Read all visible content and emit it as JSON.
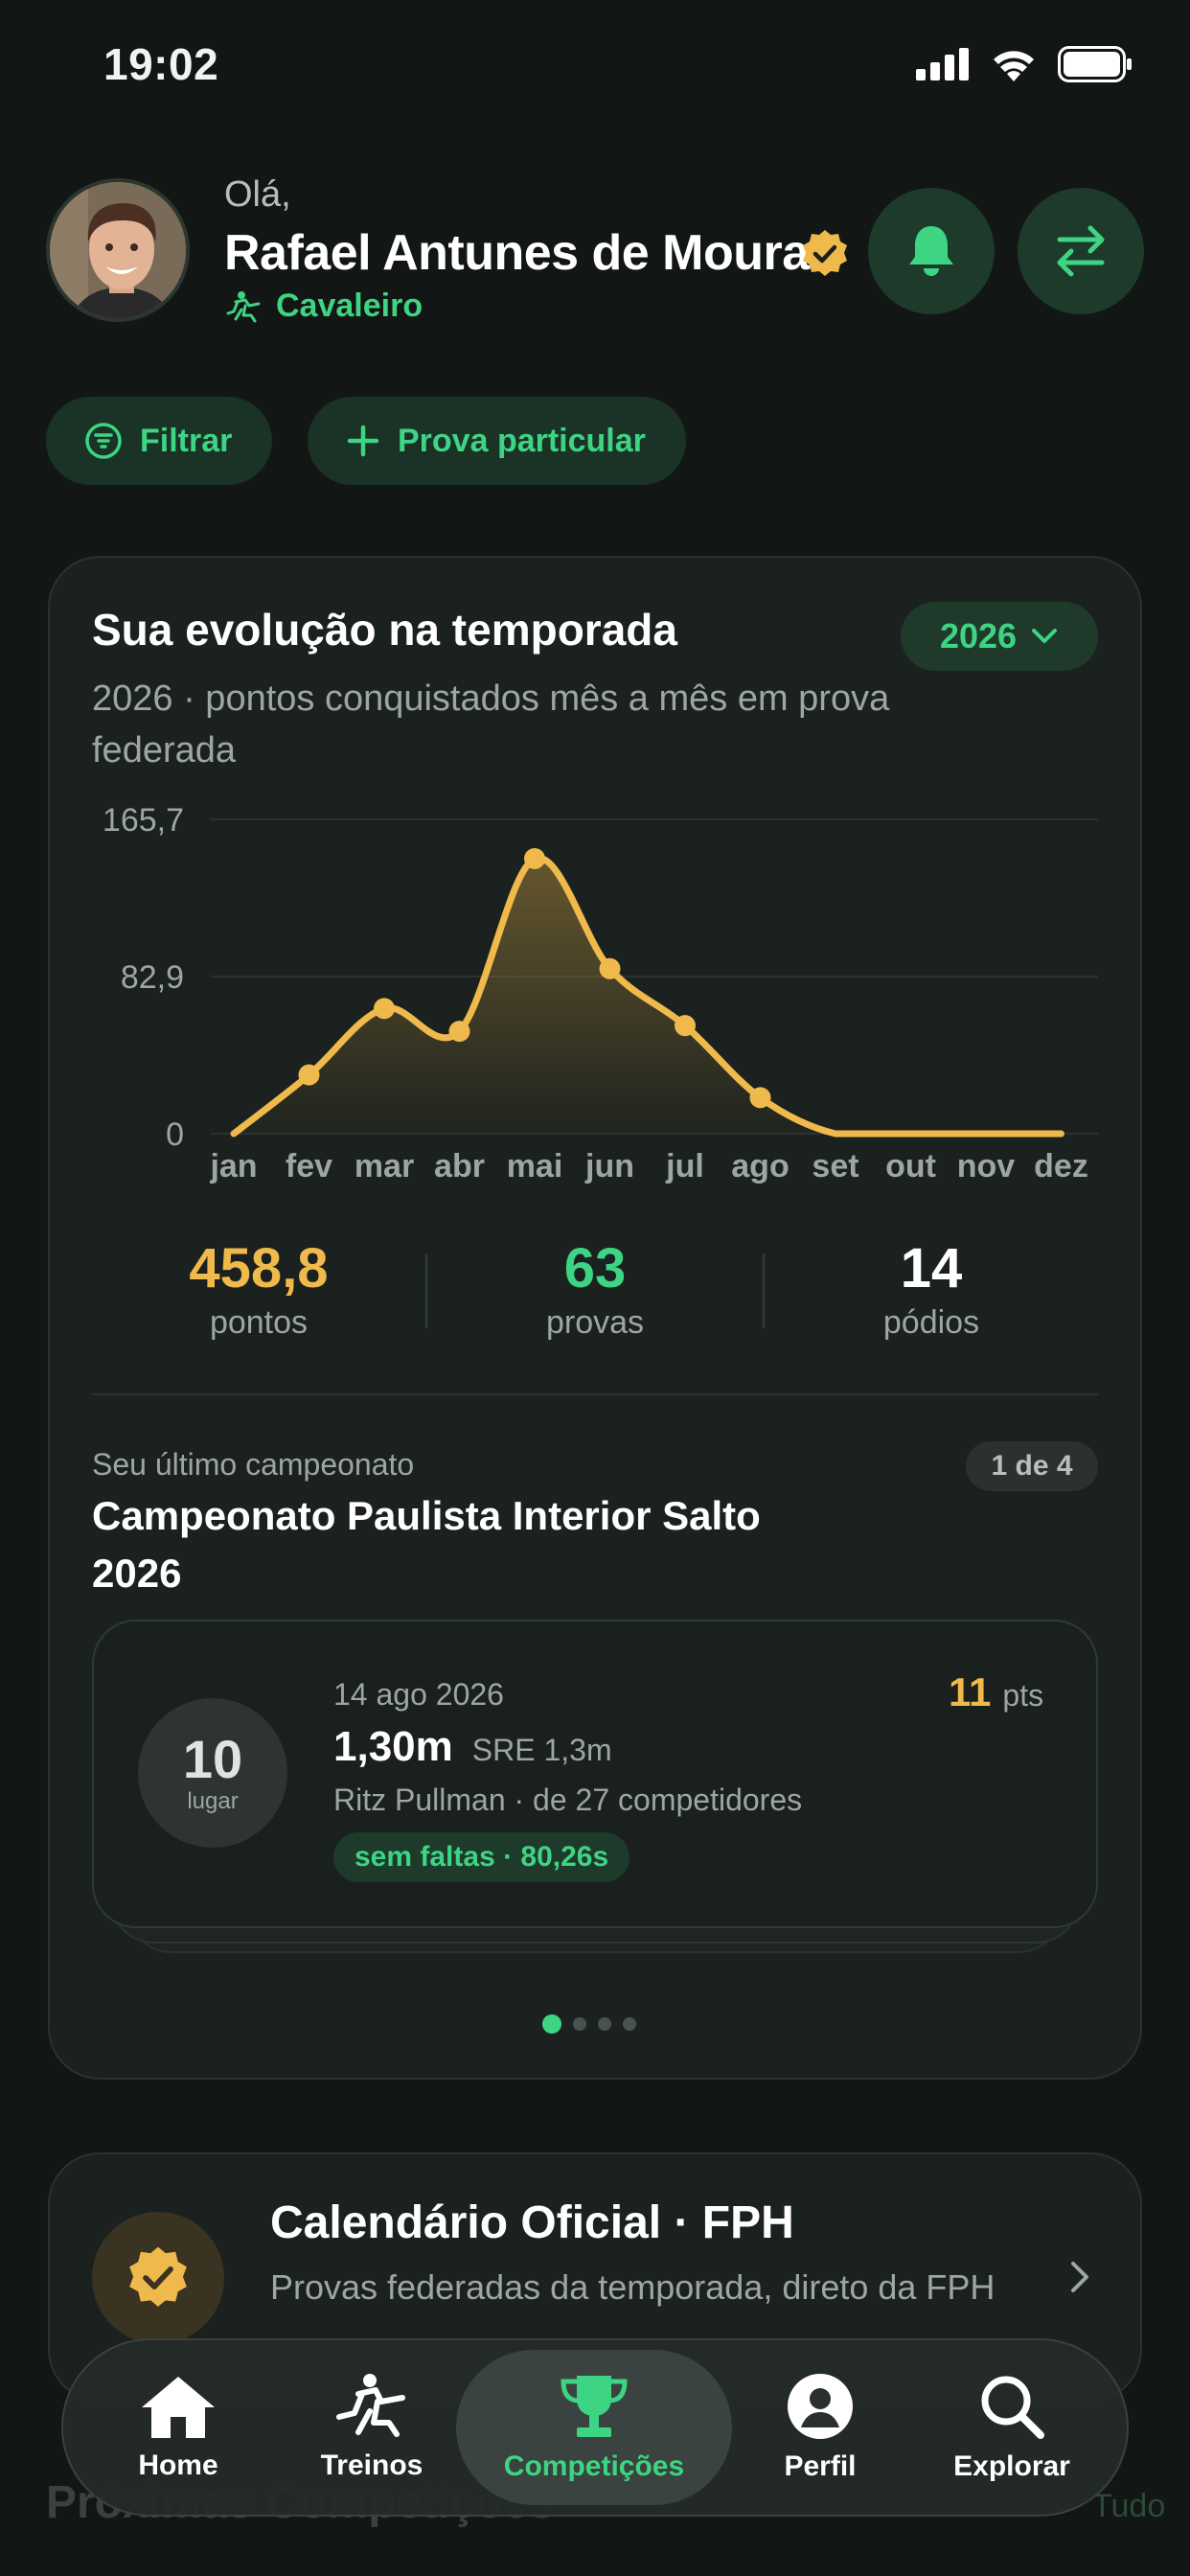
{
  "status_bar": {
    "time": "19:02"
  },
  "header": {
    "greeting": "Olá,",
    "name": "Rafael Antunes de Moura",
    "role": "Cavaleiro"
  },
  "actions": {
    "filter": "Filtrar",
    "private_event": "Prova particular"
  },
  "evolution": {
    "title": "Sua evolução na temporada",
    "year": "2026",
    "subtitle": "2026 · pontos conquistados mês a mês em prova federada",
    "stats": [
      {
        "value": "458,8",
        "label": "pontos",
        "color": "#f0b94b"
      },
      {
        "value": "63",
        "label": "provas",
        "color": "#3dd483"
      },
      {
        "value": "14",
        "label": "pódios",
        "color": "#ffffff"
      }
    ]
  },
  "chart_data": {
    "type": "area",
    "x": [
      "jan",
      "fev",
      "mar",
      "abr",
      "mai",
      "jun",
      "jul",
      "ago",
      "set",
      "out",
      "nov",
      "dez"
    ],
    "y_ticks": [
      "165,7",
      "82,9",
      "0"
    ],
    "ylim": [
      0,
      165.7
    ],
    "series": [
      {
        "values": [
          0,
          31,
          66,
          54,
          145,
          87,
          57,
          19,
          0,
          0,
          0,
          0
        ]
      }
    ],
    "color": "#f0b94b",
    "grid": true
  },
  "last_championship": {
    "label": "Seu último campeonato",
    "counter": "1 de 4",
    "title": "Campeonato Paulista Interior Salto 2026",
    "result": {
      "place": "10",
      "place_label": "lugar",
      "date": "14 ago 2026",
      "height": "1,30m",
      "category": "SRE 1,3m",
      "horse_info": "Ritz Pullman · de 27 competidores",
      "badge": "sem faltas · 80,26s",
      "points": "11",
      "points_unit": "pts"
    },
    "pager": {
      "total": 4,
      "active": 0
    }
  },
  "calendar": {
    "title": "Calendário Oficial · FPH",
    "subtitle": "Provas federadas da temporada, direto da FPH"
  },
  "upcoming": {
    "title": "Próximas Competições",
    "see_all": "Tudo"
  },
  "tabs": [
    {
      "label": "Home",
      "icon": "home-icon"
    },
    {
      "label": "Treinos",
      "icon": "rider-icon"
    },
    {
      "label": "Competições",
      "icon": "trophy-icon",
      "active": true
    },
    {
      "label": "Perfil",
      "icon": "profile-icon"
    },
    {
      "label": "Explorar",
      "icon": "search-icon"
    }
  ]
}
